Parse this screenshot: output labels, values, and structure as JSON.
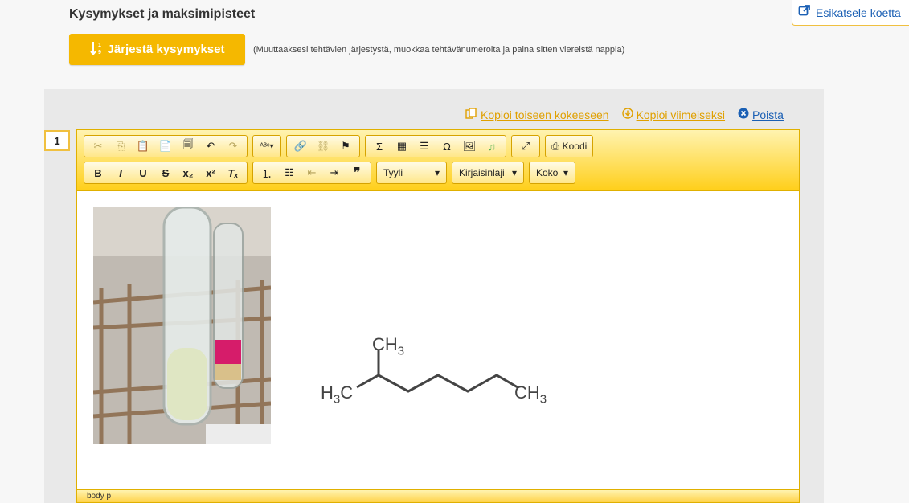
{
  "page": {
    "title": "Kysymykset ja maksimipisteet"
  },
  "preview": {
    "label": "Esikatsele koetta",
    "icon": "external-link-icon"
  },
  "sort": {
    "label": "Järjestä kysymykset",
    "hint": "(Muuttaaksesi tehtävien järjestystä, muokkaa tehtävänumeroita ja paina sitten viereistä nappia)",
    "icon": "sort-numeric-icon"
  },
  "actions": {
    "copy_other": "Kopioi toiseen kokeeseen",
    "copy_last": "Kopioi viimeiseksi",
    "delete": "Poista"
  },
  "question": {
    "number": "1"
  },
  "toolbar": {
    "source_label": "Koodi",
    "style_label": "Tyyli",
    "font_label": "Kirjaisinlaji",
    "size_label": "Koko"
  },
  "molecule": {
    "ch3_top": "CH",
    "h3c_left": "H",
    "h3c_c": "C",
    "ch3_right": "CH",
    "sub3": "3"
  },
  "status": {
    "path": "body p"
  },
  "colors": {
    "accent": "#f5b800",
    "link": "#1a5fb4",
    "copy": "#e0a000"
  }
}
